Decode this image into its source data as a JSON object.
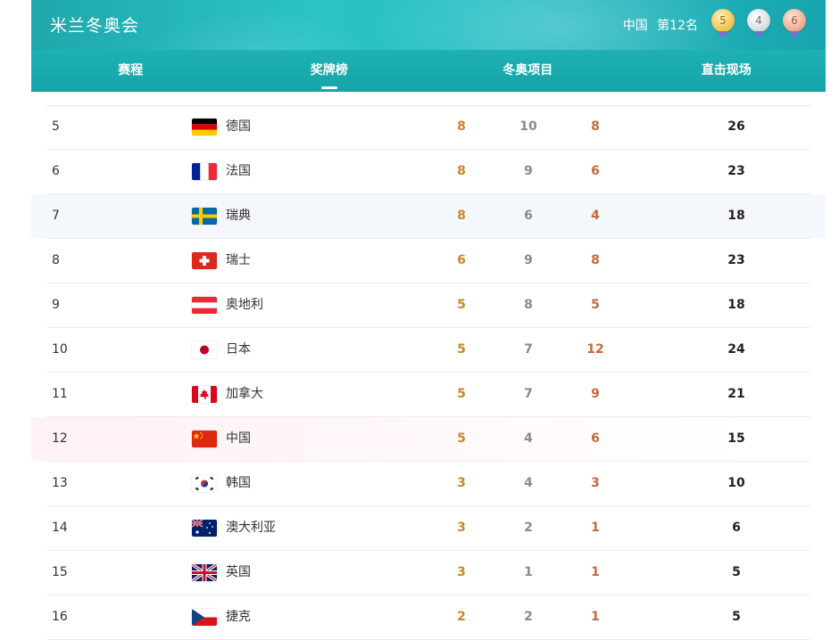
{
  "header": {
    "title": "米兰冬奥会",
    "country": "中国",
    "rank_text": "第12名",
    "medals": {
      "gold": "5",
      "silver": "4",
      "bronze": "6"
    }
  },
  "tabs": [
    {
      "label": "赛程",
      "active": false
    },
    {
      "label": "奖牌榜",
      "active": true
    },
    {
      "label": "冬奥项目",
      "active": false
    },
    {
      "label": "直击现场",
      "active": false
    }
  ],
  "rows": [
    {
      "rank": "5",
      "flag": "germany",
      "name": "德国",
      "gold": "8",
      "silver": "10",
      "bronze": "8",
      "total": "26"
    },
    {
      "rank": "6",
      "flag": "france",
      "name": "法国",
      "gold": "8",
      "silver": "9",
      "bronze": "6",
      "total": "23"
    },
    {
      "rank": "7",
      "flag": "sweden",
      "name": "瑞典",
      "gold": "8",
      "silver": "6",
      "bronze": "4",
      "total": "18"
    },
    {
      "rank": "8",
      "flag": "switzerland",
      "name": "瑞士",
      "gold": "6",
      "silver": "9",
      "bronze": "8",
      "total": "23"
    },
    {
      "rank": "9",
      "flag": "austria",
      "name": "奥地利",
      "gold": "5",
      "silver": "8",
      "bronze": "5",
      "total": "18"
    },
    {
      "rank": "10",
      "flag": "japan",
      "name": "日本",
      "gold": "5",
      "silver": "7",
      "bronze": "12",
      "total": "24"
    },
    {
      "rank": "11",
      "flag": "canada",
      "name": "加拿大",
      "gold": "5",
      "silver": "7",
      "bronze": "9",
      "total": "21"
    },
    {
      "rank": "12",
      "flag": "china",
      "name": "中国",
      "gold": "5",
      "silver": "4",
      "bronze": "6",
      "total": "15"
    },
    {
      "rank": "13",
      "flag": "south-korea",
      "name": "韩国",
      "gold": "3",
      "silver": "4",
      "bronze": "3",
      "total": "10"
    },
    {
      "rank": "14",
      "flag": "australia",
      "name": "澳大利亚",
      "gold": "3",
      "silver": "2",
      "bronze": "1",
      "total": "6"
    },
    {
      "rank": "15",
      "flag": "uk",
      "name": "英国",
      "gold": "3",
      "silver": "1",
      "bronze": "1",
      "total": "5"
    },
    {
      "rank": "16",
      "flag": "czech",
      "name": "捷克",
      "gold": "2",
      "silver": "2",
      "bronze": "1",
      "total": "5"
    }
  ],
  "colors": {
    "header_teal": "#28bfc4",
    "gold_text": "#c9862b",
    "silver_text": "#8a8a8a",
    "bronze_text": "#c46a3c"
  }
}
